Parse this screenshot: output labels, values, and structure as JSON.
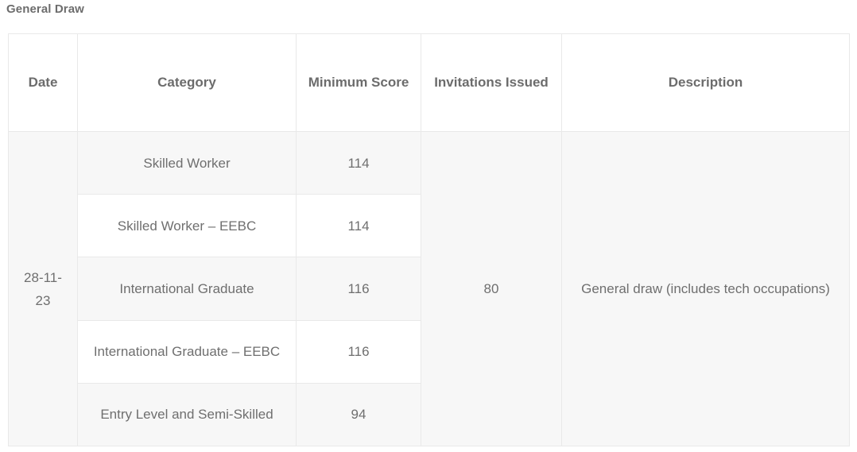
{
  "section": {
    "title": "General Draw"
  },
  "table": {
    "headers": [
      {
        "label": "Date",
        "name": "date"
      },
      {
        "label": "Category",
        "name": "category"
      },
      {
        "label": "Minimum Score",
        "name": "minimum-score"
      },
      {
        "label": "Invitations Issued",
        "name": "invitations-issued"
      },
      {
        "label": "Description",
        "name": "description"
      }
    ],
    "group": {
      "date": "28-11-23",
      "invitations_issued": "80",
      "description": "General draw (includes tech occupations)"
    },
    "rows": [
      {
        "category": "Skilled Worker",
        "minimum_score": "114",
        "shade": "alt"
      },
      {
        "category": "Skilled Worker – EEBC",
        "minimum_score": "114",
        "shade": "base"
      },
      {
        "category": "International Graduate",
        "minimum_score": "116",
        "shade": "alt"
      },
      {
        "category": "International Graduate – EEBC",
        "minimum_score": "116",
        "shade": "base"
      },
      {
        "category": "Entry Level and Semi-Skilled",
        "minimum_score": "94",
        "shade": "alt"
      }
    ]
  },
  "colors": {
    "text": "#6f6f6f",
    "header_text": "#6c6c6c",
    "title_text": "#6d6d6d",
    "border": "#e9e9e9",
    "row_alt": "#f7f7f7",
    "row_base": "#ffffff",
    "page_bg": "#ffffff"
  }
}
